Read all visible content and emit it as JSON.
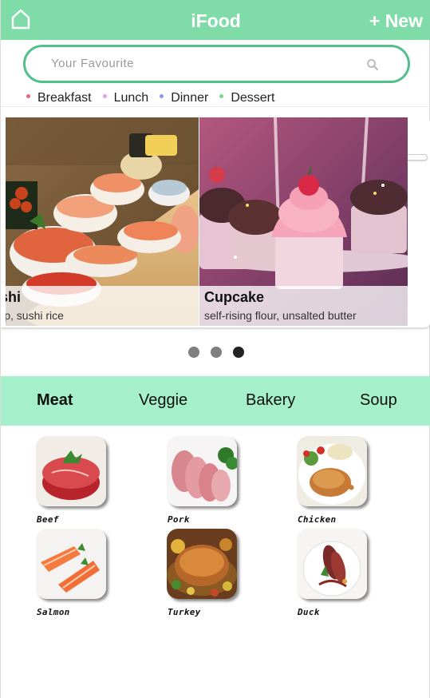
{
  "header": {
    "title": "iFood",
    "new_label": "+ New",
    "color": "#7fdba7"
  },
  "search": {
    "placeholder": "Your Favourite",
    "border_color": "#52c08a"
  },
  "filters": [
    {
      "label": "Breakfast",
      "color": "#e06b78"
    },
    {
      "label": "Lunch",
      "color": "#e19ef2"
    },
    {
      "label": "Dinner",
      "color": "#8b93f0"
    },
    {
      "label": "Dessert",
      "color": "#7ed987"
    }
  ],
  "carousel": {
    "slides": [
      {
        "title": "ushi",
        "subtitle": "hrimp, sushi rice",
        "image": "sushi platter"
      },
      {
        "title": "Cupcake",
        "subtitle": "self-rising flour, unsalted butter",
        "image": "pink frosted cupcakes"
      }
    ],
    "page_count": 3,
    "active_page": 3
  },
  "tabs": [
    {
      "label": "Meat",
      "active": true
    },
    {
      "label": "Veggie",
      "active": false
    },
    {
      "label": "Bakery",
      "active": false
    },
    {
      "label": "Soup",
      "active": false
    }
  ],
  "tabs_color": "#a5f0ca",
  "foods": [
    {
      "label": "Beef",
      "image": "raw beef steak"
    },
    {
      "label": "Pork",
      "image": "sliced pork"
    },
    {
      "label": "Chicken",
      "image": "roast chicken leg"
    },
    {
      "label": "Salmon",
      "image": "salmon fillets"
    },
    {
      "label": "Turkey",
      "image": "roast turkey"
    },
    {
      "label": "Duck",
      "image": "sliced duck breast"
    }
  ]
}
